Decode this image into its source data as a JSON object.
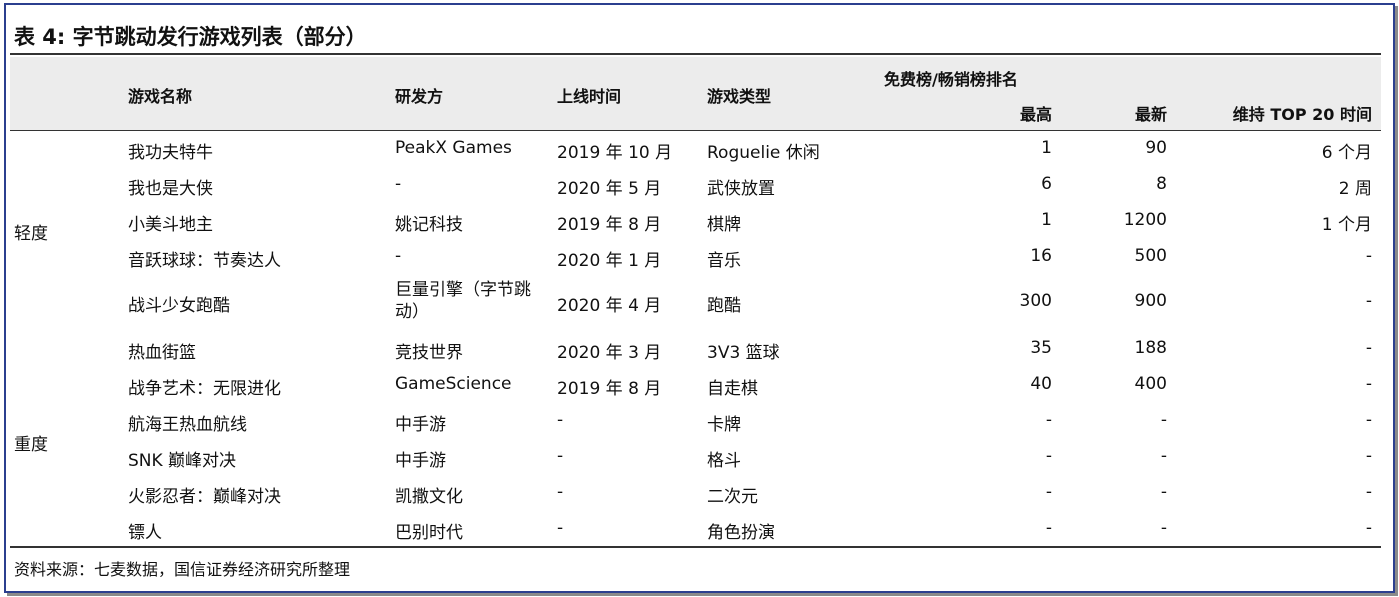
{
  "title": "表 4:  字节跳动发行游戏列表（部分）",
  "header": {
    "name": "游戏名称",
    "developer": "研发方",
    "launch": "上线时间",
    "genre": "游戏类型",
    "rank_group": "免费榜/畅销榜排名",
    "best": "最高",
    "latest": "最新",
    "top20": "维持 TOP 20 时间"
  },
  "categories": [
    "轻度",
    "重度"
  ],
  "rows": [
    {
      "name": "我功夫特牛",
      "developer": "PeakX Games",
      "launch": "2019 年 10 月",
      "genre": "Roguelie 休闲",
      "best": "1",
      "latest": "90",
      "top20": "6 个月"
    },
    {
      "name": "我也是大侠",
      "developer": "-",
      "launch": "2020 年 5 月",
      "genre": "武侠放置",
      "best": "6",
      "latest": "8",
      "top20": "2 周"
    },
    {
      "name": "小美斗地主",
      "developer": "姚记科技",
      "launch": "2019 年 8 月",
      "genre": "棋牌",
      "best": "1",
      "latest": "1200",
      "top20": "1 个月"
    },
    {
      "name": "音跃球球：节奏达人",
      "developer": "-",
      "launch": "2020 年 1 月",
      "genre": "音乐",
      "best": "16",
      "latest": "500",
      "top20": "-"
    },
    {
      "name": "战斗少女跑酷",
      "developer": "巨量引擎（字节跳动）",
      "launch": "2020 年 4 月",
      "genre": "跑酷",
      "best": "300",
      "latest": "900",
      "top20": "-"
    },
    {
      "name": "热血街篮",
      "developer": "竞技世界",
      "launch": "2020 年 3 月",
      "genre": "3V3 篮球",
      "best": "35",
      "latest": "188",
      "top20": "-"
    },
    {
      "name": "战争艺术：无限进化",
      "developer": "GameScience",
      "launch": "2019 年 8 月",
      "genre": "自走棋",
      "best": "40",
      "latest": "400",
      "top20": "-"
    },
    {
      "name": "航海王热血航线",
      "developer": "中手游",
      "launch": "-",
      "genre": "卡牌",
      "best": "-",
      "latest": "-",
      "top20": "-"
    },
    {
      "name": "SNK 巅峰对决",
      "developer": "中手游",
      "launch": "-",
      "genre": "格斗",
      "best": "-",
      "latest": "-",
      "top20": "-"
    },
    {
      "name": "火影忍者：巅峰对决",
      "developer": "凯撒文化",
      "launch": "-",
      "genre": "二次元",
      "best": "-",
      "latest": "-",
      "top20": "-"
    },
    {
      "name": "镖人",
      "developer": "巴别时代",
      "launch": "-",
      "genre": "角色扮演",
      "best": "-",
      "latest": "-",
      "top20": "-"
    }
  ],
  "source": "资料来源：七麦数据，国信证券经济研究所整理"
}
